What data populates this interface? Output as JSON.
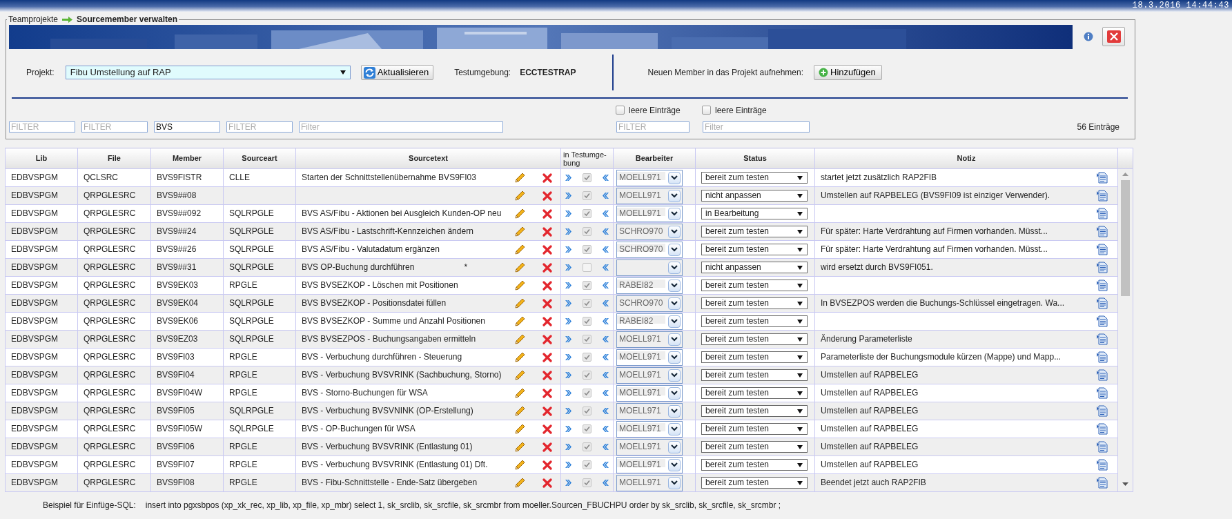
{
  "top_bar": {
    "datetime": "18.3.2016 14:44:43"
  },
  "breadcrumb": {
    "parent": "Teamprojekte",
    "current": "Sourcemember verwalten"
  },
  "project": {
    "label": "Projekt:",
    "value": "Fibu Umstellung auf RAP",
    "refresh_button": "Aktualisieren",
    "test_env_label": "Testumgebung:",
    "test_env_value": "ECCTESTRAP",
    "add_label": "Neuen Member in das Projekt aufnehmen:",
    "add_button": "Hinzufügen"
  },
  "empty_filters": [
    {
      "label": "leere Einträge",
      "checked": false
    },
    {
      "label": "leere Einträge",
      "checked": false
    }
  ],
  "filters": [
    {
      "placeholder": "FILTER"
    },
    {
      "placeholder": "FILTER"
    },
    {
      "value": "BVS"
    },
    {
      "placeholder": "FILTER"
    },
    {
      "placeholder": "Filter"
    },
    {
      "placeholder": "FILTER"
    },
    {
      "placeholder": "Filter"
    }
  ],
  "entry_count": "56 Einträge",
  "table": {
    "columns": [
      "Lib",
      "File",
      "Member",
      "Sourceart",
      "Sourcetext",
      "in Testumge-bung",
      "Bearbeiter",
      "Status",
      "Notiz"
    ],
    "rows": [
      {
        "lib": "EDBVSPGM",
        "file": "QCLSRC",
        "member": "BVS9FISTR",
        "sourceart": "CLLE",
        "sourcetext": "Starten der Schnittstellenübernahme BVS9FI03",
        "in_test": true,
        "bearbeiter": "MOELL971",
        "status": "bereit zum testen",
        "notiz": "startet jetzt zusätzlich RAP2FIB"
      },
      {
        "lib": "EDBVSPGM",
        "file": "QRPGLESRC",
        "member": "BVS9##08",
        "in_test": true,
        "bearbeiter": "MOELL971",
        "status": "nicht anpassen",
        "notiz": "Umstellen auf RAPBELEG (BVS9FI09 ist einziger Verwender)."
      },
      {
        "lib": "EDBVSPGM",
        "file": "QRPGLESRC",
        "member": "BVS9##092",
        "sourceart": "SQLRPGLE",
        "sourcetext": "BVS AS/Fibu - Aktionen bei Ausgleich Kunden-OP neu",
        "in_test": true,
        "bearbeiter": "MOELL971",
        "status": "in Bearbeitung"
      },
      {
        "lib": "EDBVSPGM",
        "file": "QRPGLESRC",
        "member": "BVS9##24",
        "sourceart": "SQLRPGLE",
        "sourcetext": "BVS AS/Fibu - Lastschrift-Kennzeichen ändern",
        "in_test": true,
        "bearbeiter": "SCHRO970",
        "status": "bereit zum testen",
        "notiz": "Für später: Harte Verdrahtung auf Firmen vorhanden. Müsst..."
      },
      {
        "lib": "EDBVSPGM",
        "file": "QRPGLESRC",
        "member": "BVS9##26",
        "sourceart": "SQLRPGLE",
        "sourcetext": "BVS AS/Fibu - Valutadatum ergänzen",
        "in_test": true,
        "bearbeiter": "SCHRO970",
        "status": "bereit zum testen",
        "notiz": "Für später: Harte Verdrahtung auf Firmen vorhanden. Müsst..."
      },
      {
        "lib": "EDBVSPGM",
        "file": "QRPGLESRC",
        "member": "BVS9##31",
        "sourceart": "SQLRPGLE",
        "sourcetext": "BVS OP-Buchung durchführen",
        "mark": "*",
        "in_test": false,
        "status": "nicht anpassen",
        "notiz": "wird ersetzt durch BVS9FI051."
      },
      {
        "lib": "EDBVSPGM",
        "file": "QRPGLESRC",
        "member": "BVS9EK03",
        "sourceart": "RPGLE",
        "sourcetext": "BVS BVSEZKOP - Löschen mit Positionen",
        "in_test": true,
        "bearbeiter": "RABEI82",
        "status": "bereit zum testen"
      },
      {
        "lib": "EDBVSPGM",
        "file": "QRPGLESRC",
        "member": "BVS9EK04",
        "sourceart": "SQLRPGLE",
        "sourcetext": "BVS BVSEZKOP - Positionsdatei füllen",
        "in_test": true,
        "bearbeiter": "SCHRO970",
        "status": "bereit zum testen",
        "notiz": "In BVSEZPOS werden die Buchungs-Schlüssel eingetragen. Wa..."
      },
      {
        "lib": "EDBVSPGM",
        "file": "QRPGLESRC",
        "member": "BVS9EK06",
        "sourceart": "SQLRPGLE",
        "sourcetext": "BVS BVSEZKOP - Summe und Anzahl Positionen",
        "in_test": true,
        "bearbeiter": "RABEI82",
        "status": "bereit zum testen"
      },
      {
        "lib": "EDBVSPGM",
        "file": "QRPGLESRC",
        "member": "BVS9EZ03",
        "sourceart": "SQLRPGLE",
        "sourcetext": "BVS BVSEZPOS - Buchungsangaben ermitteln",
        "in_test": true,
        "bearbeiter": "MOELL971",
        "status": "bereit zum testen",
        "notiz": "Änderung Parameterliste"
      },
      {
        "lib": "EDBVSPGM",
        "file": "QRPGLESRC",
        "member": "BVS9FI03",
        "sourceart": "RPGLE",
        "sourcetext": "BVS - Verbuchung durchführen - Steuerung",
        "in_test": true,
        "bearbeiter": "MOELL971",
        "status": "bereit zum testen",
        "notiz": "Parameterliste der Buchungsmodule kürzen (Mappe) und Mapp..."
      },
      {
        "lib": "EDBVSPGM",
        "file": "QRPGLESRC",
        "member": "BVS9FI04",
        "sourceart": "RPGLE",
        "sourcetext": "BVS - Verbuchung BVSVRINK (Sachbuchung, Storno)",
        "in_test": true,
        "bearbeiter": "MOELL971",
        "status": "bereit zum testen",
        "notiz": "Umstellen auf RAPBELEG"
      },
      {
        "lib": "EDBVSPGM",
        "file": "QRPGLESRC",
        "member": "BVS9FI04W",
        "sourceart": "RPGLE",
        "sourcetext": "BVS - Storno-Buchungen für WSA",
        "in_test": true,
        "bearbeiter": "MOELL971",
        "status": "bereit zum testen",
        "notiz": "Umstellen auf RAPBELEG"
      },
      {
        "lib": "EDBVSPGM",
        "file": "QRPGLESRC",
        "member": "BVS9FI05",
        "sourceart": "SQLRPGLE",
        "sourcetext": "BVS - Verbuchung BVSVNINK (OP-Erstellung)",
        "in_test": true,
        "bearbeiter": "MOELL971",
        "status": "bereit zum testen",
        "notiz": "Umstellen auf RAPBELEG"
      },
      {
        "lib": "EDBVSPGM",
        "file": "QRPGLESRC",
        "member": "BVS9FI05W",
        "sourceart": "SQLRPGLE",
        "sourcetext": "BVS - OP-Buchungen für WSA",
        "in_test": true,
        "bearbeiter": "MOELL971",
        "status": "bereit zum testen",
        "notiz": "Umstellen auf RAPBELEG"
      },
      {
        "lib": "EDBVSPGM",
        "file": "QRPGLESRC",
        "member": "BVS9FI06",
        "sourceart": "RPGLE",
        "sourcetext": "BVS - Verbuchung BVSVRINK (Entlastung 01)",
        "in_test": true,
        "bearbeiter": "MOELL971",
        "status": "bereit zum testen",
        "notiz": "Umstellen auf RAPBELEG"
      },
      {
        "lib": "EDBVSPGM",
        "file": "QRPGLESRC",
        "member": "BVS9FI07",
        "sourceart": "RPGLE",
        "sourcetext": "BVS - Verbuchung BVSVRINK (Entlastung 01) Dft.",
        "in_test": true,
        "bearbeiter": "MOELL971",
        "status": "bereit zum testen",
        "notiz": "Umstellen auf RAPBELEG"
      },
      {
        "lib": "EDBVSPGM",
        "file": "QRPGLESRC",
        "member": "BVS9FI08",
        "sourceart": "RPGLE",
        "sourcetext": "BVS - Fibu-Schnittstelle - Ende-Satz übergeben",
        "in_test": true,
        "bearbeiter": "MOELL971",
        "status": "bereit zum testen",
        "notiz": "Beendet jetzt auch RAP2FIB"
      }
    ]
  },
  "footer": {
    "label": "Beispiel für Einfüge-SQL:",
    "sql": "insert into pgxsbpos (xp_xk_rec, xp_lib, xp_file, xp_mbr) select 1, sk_srclib, sk_srcfile, sk_srcmbr from moeller.Sourcen_FBUCHPU order by sk_srclib, sk_srcfile, sk_srcmbr ;"
  }
}
